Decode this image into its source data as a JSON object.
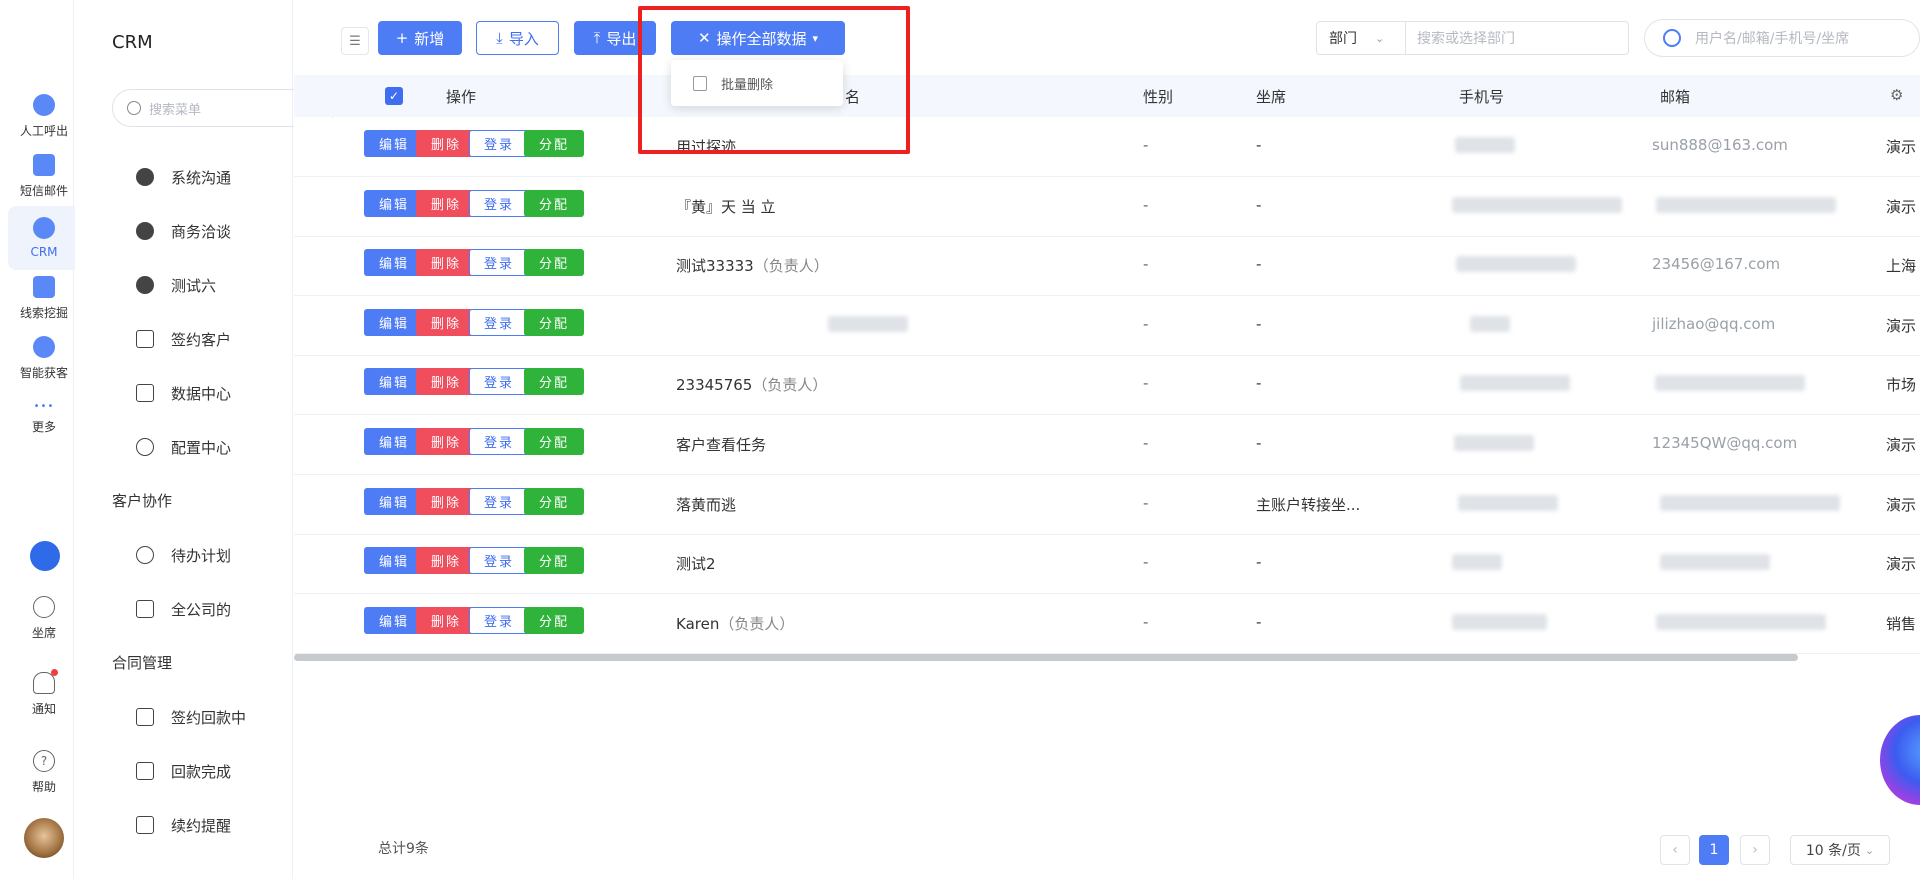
{
  "rail": {
    "items": [
      {
        "label": "人工呼出",
        "icon": "phone-outbound-icon"
      },
      {
        "label": "短信邮件",
        "icon": "message-icon"
      },
      {
        "label": "CRM",
        "icon": "crm-icon"
      },
      {
        "label": "线索挖掘",
        "icon": "lead-mining-icon"
      },
      {
        "label": "智能获客",
        "icon": "smart-acquire-icon"
      },
      {
        "label": "更多",
        "icon": "more-icon"
      },
      {
        "label": "坐席",
        "icon": "headset-icon"
      },
      {
        "label": "通知",
        "icon": "bell-icon"
      },
      {
        "label": "帮助",
        "icon": "help-icon"
      }
    ],
    "more_glyph": "•••",
    "help_glyph": "?"
  },
  "menu": {
    "title": "CRM",
    "search_placeholder": "搜索菜单",
    "items": [
      {
        "label": "系统沟通"
      },
      {
        "label": "商务洽谈"
      },
      {
        "label": "测试六"
      },
      {
        "label": "签约客户"
      },
      {
        "label": "数据中心"
      },
      {
        "label": "配置中心"
      }
    ],
    "group1": "客户协作",
    "group1_items": [
      {
        "label": "待办计划"
      },
      {
        "label": "全公司的"
      }
    ],
    "group2": "合同管理",
    "group2_items": [
      {
        "label": "签约回款中"
      },
      {
        "label": "回款完成"
      },
      {
        "label": "续约提醒"
      }
    ]
  },
  "toolbar": {
    "add": "新增",
    "import": "导入",
    "export": "导出",
    "bulk_ops": "操作全部数据",
    "add_glyph": "+",
    "import_glyph": "⤓",
    "export_glyph": "⤒",
    "bulk_glyph": "✕",
    "caret_glyph": "▾"
  },
  "dropdown": {
    "bulk_delete": "批量删除"
  },
  "filters": {
    "dept_label": "部门",
    "dept_placeholder": "搜索或选择部门",
    "user_placeholder": "用户名/邮箱/手机号/坐席"
  },
  "table": {
    "headers": {
      "action": "操作",
      "username": "户名",
      "gender": "性别",
      "seat": "坐席",
      "phone": "手机号",
      "email": "邮箱"
    },
    "action_labels": {
      "edit": "编辑",
      "delete": "删除",
      "login": "登录",
      "assign": "分配"
    },
    "rows": [
      {
        "name": "用过探迹",
        "sub": "",
        "gender": "-",
        "seat": "-",
        "email": "sun888@163.com",
        "extra": "演示"
      },
      {
        "name": "『黄』天 当 立",
        "sub": "",
        "gender": "-",
        "seat": "-",
        "email": "",
        "extra": "演示"
      },
      {
        "name": "测试33333",
        "sub": "（负责人）",
        "gender": "-",
        "seat": "-",
        "email": "23456@167.com",
        "extra": "上海"
      },
      {
        "name": "",
        "sub": "",
        "gender": "-",
        "seat": "-",
        "email": "jilizhao@qq.com",
        "extra": "演示"
      },
      {
        "name": "23345765",
        "sub": "（负责人）",
        "gender": "-",
        "seat": "-",
        "email": "",
        "extra": "市场"
      },
      {
        "name": "客户查看任务",
        "sub": "",
        "gender": "-",
        "seat": "-",
        "email": "12345QW@qq.com",
        "extra": "演示"
      },
      {
        "name": "落黄而逃",
        "sub": "",
        "gender": "-",
        "seat": "主账户转接坐...",
        "email": "",
        "extra": "演示"
      },
      {
        "name": "测试2",
        "sub": "",
        "gender": "-",
        "seat": "-",
        "email": "",
        "extra": "演示"
      },
      {
        "name": "Karen",
        "sub": "（负责人）",
        "gender": "-",
        "seat": "-",
        "email": "",
        "extra": "销售"
      }
    ]
  },
  "footer": {
    "total": "总计9条",
    "page": "1",
    "page_size": "10 条/页",
    "prev_glyph": "‹",
    "next_glyph": "›"
  }
}
